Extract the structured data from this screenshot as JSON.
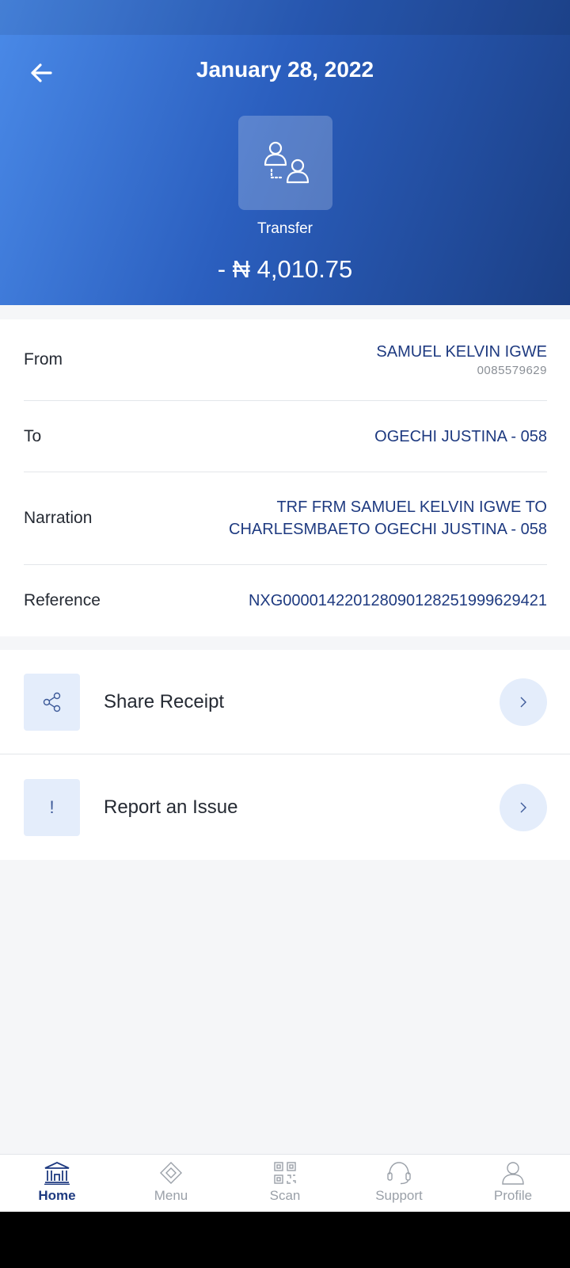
{
  "header": {
    "title": "January 28, 2022",
    "transaction_type": "Transfer",
    "amount": "- ₦ 4,010.75"
  },
  "details": {
    "from": {
      "label": "From",
      "name": "SAMUEL KELVIN IGWE",
      "account": "0085579629"
    },
    "to": {
      "label": "To",
      "value": "OGECHI JUSTINA - 058"
    },
    "narration": {
      "label": "Narration",
      "line1": "TRF FRM SAMUEL KELVIN IGWE TO",
      "line2": "CHARLESMBAETO OGECHI JUSTINA - 058"
    },
    "reference": {
      "label": "Reference",
      "value": "NXG000014220128090128251999629421"
    }
  },
  "actions": {
    "share_receipt": "Share Receipt",
    "report_issue": "Report an Issue",
    "report_icon_glyph": "!"
  },
  "nav": {
    "items": [
      {
        "label": "Home",
        "icon": "home-icon",
        "active": true
      },
      {
        "label": "Menu",
        "icon": "menu-icon",
        "active": false
      },
      {
        "label": "Scan",
        "icon": "scan-icon",
        "active": false
      },
      {
        "label": "Support",
        "icon": "support-icon",
        "active": false
      },
      {
        "label": "Profile",
        "icon": "profile-icon",
        "active": false
      }
    ]
  },
  "colors": {
    "primary": "#1e3a80",
    "header_gradient_start": "#4a8ae8",
    "header_gradient_end": "#1b3f85",
    "icon_bg": "#e4edfb"
  }
}
